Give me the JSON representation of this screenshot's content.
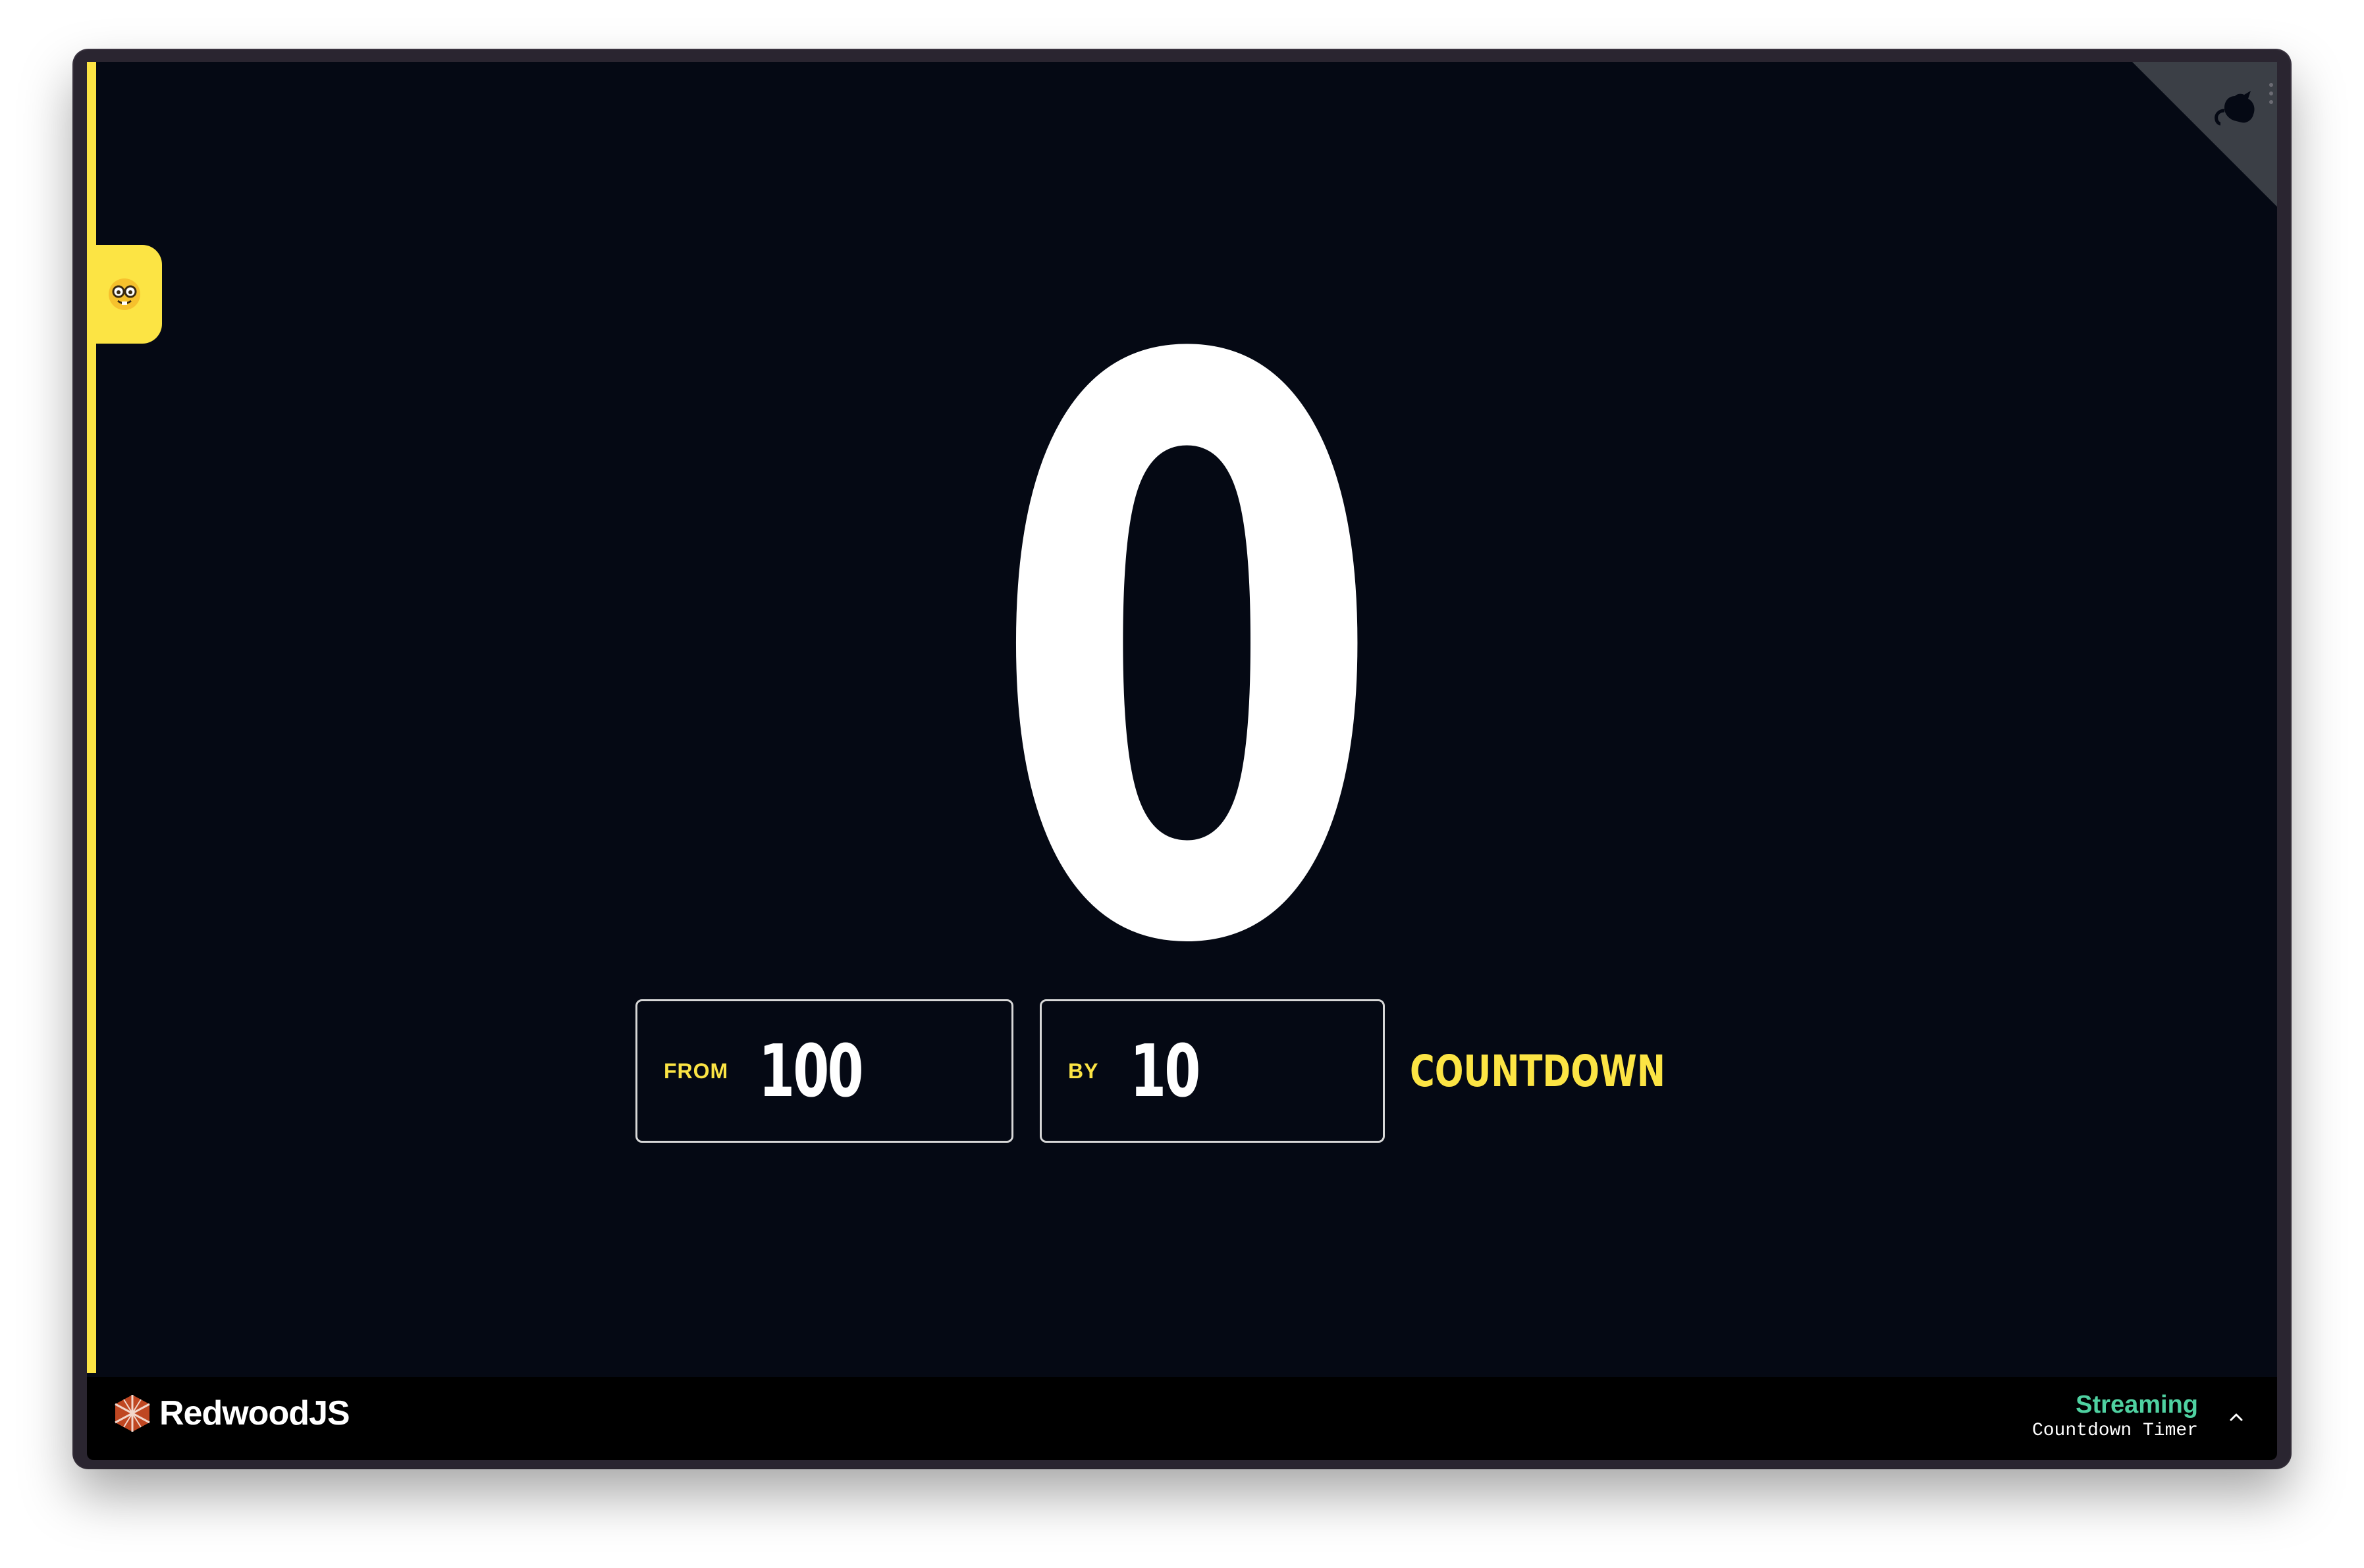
{
  "timer": {
    "current_value": "0"
  },
  "controls": {
    "from_label": "FROM",
    "from_value": "100",
    "by_label": "BY",
    "by_value": "10",
    "countdown_label": "COUNTDOWN"
  },
  "footer": {
    "brand_name": "RedwoodJS",
    "status_title": "Streaming",
    "status_subtitle": "Countdown Timer"
  },
  "icons": {
    "side_tab": "nerd-face-icon",
    "corner": "github-octocat-icon",
    "brand": "redwood-logo-icon",
    "expand": "chevron-up-icon",
    "menu": "kebab-menu-icon"
  },
  "colors": {
    "background": "#050914",
    "accent": "#fce444",
    "status_green": "#4fd1a1",
    "text": "#ffffff"
  }
}
